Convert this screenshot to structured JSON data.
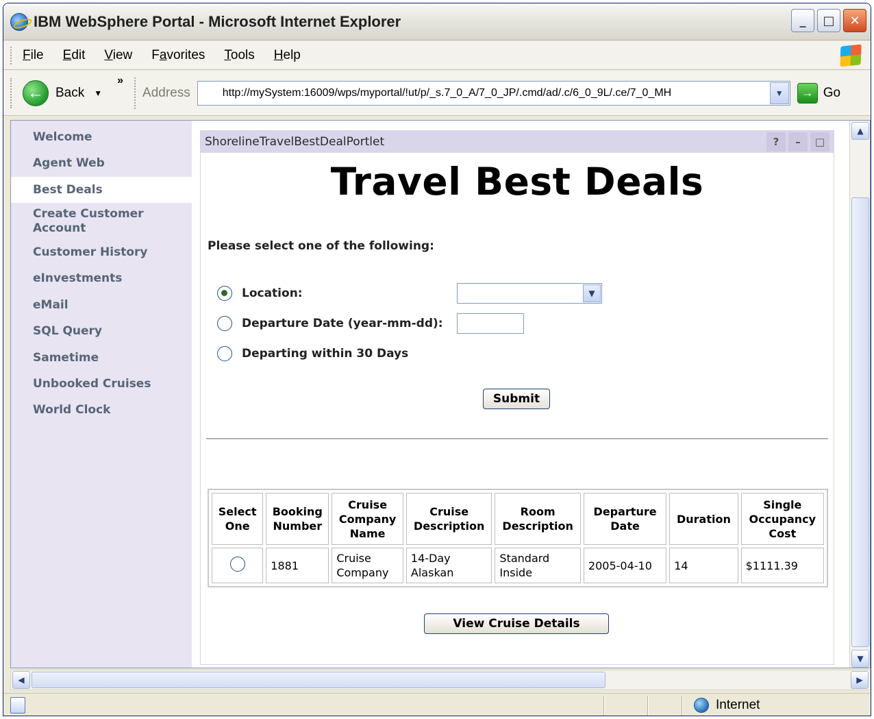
{
  "window": {
    "title": "IBM WebSphere Portal - Microsoft Internet Explorer",
    "buttons": {
      "minimize": "_",
      "maximize": "□",
      "close": "✕"
    }
  },
  "menubar": {
    "items": [
      {
        "key": "F",
        "rest": "ile"
      },
      {
        "key": "E",
        "rest": "dit"
      },
      {
        "key": "V",
        "rest": "iew"
      },
      {
        "pre": "F",
        "key": "a",
        "rest": "vorites"
      },
      {
        "key": "T",
        "rest": "ools"
      },
      {
        "key": "H",
        "rest": "elp"
      }
    ]
  },
  "toolbar": {
    "back_label": "Back",
    "chevrons": "»",
    "address_label": "Address",
    "address_value": "http://mySystem:16009/wps/myportal/!ut/p/_s.7_0_A/7_0_JP/.cmd/ad/.c/6_0_9L/.ce/7_0_MH",
    "go_label": "Go"
  },
  "nav": {
    "items": [
      {
        "label": "Welcome",
        "active": false
      },
      {
        "label": "Agent Web",
        "active": false
      },
      {
        "label": "Best Deals",
        "active": true
      },
      {
        "label": "Create Customer Account",
        "active": false
      },
      {
        "label": "Customer History",
        "active": false
      },
      {
        "label": "eInvestments",
        "active": false
      },
      {
        "label": "eMail",
        "active": false
      },
      {
        "label": "SQL Query",
        "active": false
      },
      {
        "label": "Sametime",
        "active": false
      },
      {
        "label": "Unbooked Cruises",
        "active": false
      },
      {
        "label": "World Clock",
        "active": false
      }
    ]
  },
  "portlet": {
    "title": "ShorelineTravelBestDealPortlet",
    "controls": {
      "help": "?",
      "minimize": "–",
      "maximize": "□"
    },
    "heading": "Travel Best Deals",
    "prompt": "Please select one of the following:",
    "options": {
      "location": "Location:",
      "departure_date": "Departure Date (year-mm-dd):",
      "within_30": "Departing within 30 Days"
    },
    "submit_label": "Submit",
    "view_details_label": "View Cruise Details",
    "table": {
      "headers": [
        "Select One",
        "Booking Number",
        "Cruise Company Name",
        "Cruise Description",
        "Room Description",
        "Departure Date",
        "Duration",
        "Single Occupancy Cost"
      ],
      "rows": [
        {
          "booking_number": "1881",
          "company": "Cruise Company",
          "description": "14-Day Alaskan",
          "room": "Standard Inside",
          "departure": "2005-04-10",
          "duration": "14",
          "cost": "$1111.39"
        }
      ]
    }
  },
  "status": {
    "zone": "Internet"
  }
}
